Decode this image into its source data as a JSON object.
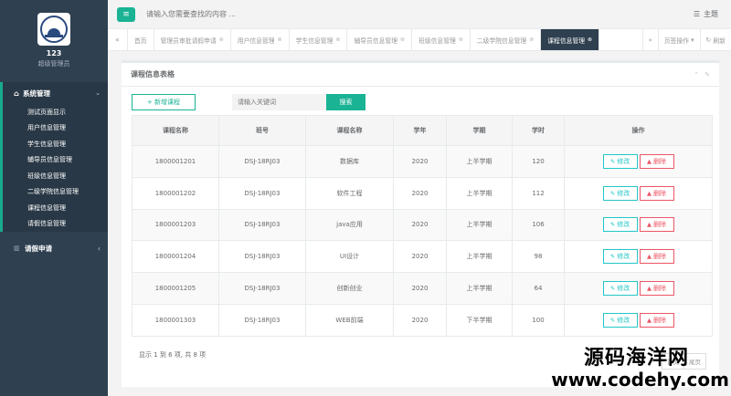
{
  "profile": {
    "username": "123",
    "role": "超级管理员"
  },
  "sidebar": {
    "group_label": "系统管理",
    "items": [
      {
        "label": "测试页面显示"
      },
      {
        "label": "用户信息管理"
      },
      {
        "label": "学生信息管理"
      },
      {
        "label": "辅导员信息管理"
      },
      {
        "label": "班级信息管理"
      },
      {
        "label": "二级学院信息管理"
      },
      {
        "label": "课程信息管理"
      },
      {
        "label": "请假信息管理"
      }
    ],
    "group2_label": "请假申请"
  },
  "topbar": {
    "search_placeholder": "请输入您需要查找的内容 ...",
    "theme_label": "主题"
  },
  "tabs": [
    {
      "label": "首页",
      "closable": false
    },
    {
      "label": "管理员审批请假申请",
      "closable": true
    },
    {
      "label": "用户信息管理",
      "closable": true
    },
    {
      "label": "学生信息管理",
      "closable": true
    },
    {
      "label": "辅导员信息管理",
      "closable": true
    },
    {
      "label": "班级信息管理",
      "closable": true
    },
    {
      "label": "二级学院信息管理",
      "closable": true
    },
    {
      "label": "课程信息管理",
      "closable": true,
      "active": true
    }
  ],
  "tab_actions": {
    "page_ops": "页签操作",
    "refresh": "刷新"
  },
  "panel": {
    "title": "课程信息表格",
    "add_button": "新增课程",
    "keyword_placeholder": "请输入关键词",
    "search_button": "搜索"
  },
  "table": {
    "headers": [
      "课程名称",
      "班号",
      "课程名称",
      "学年",
      "学期",
      "学时",
      "操作"
    ],
    "rows": [
      [
        "1800001201",
        "DSJ-18RJ03",
        "数据库",
        "2020",
        "上半学期",
        "120"
      ],
      [
        "1800001202",
        "DSJ-18RJ03",
        "软件工程",
        "2020",
        "上半学期",
        "112"
      ],
      [
        "1800001203",
        "DSJ-18RJ03",
        "java应用",
        "2020",
        "上半学期",
        "106"
      ],
      [
        "1800001204",
        "DSJ-18RJ03",
        "UI设计",
        "2020",
        "上半学期",
        "98"
      ],
      [
        "1800001205",
        "DSJ-18RJ03",
        "创新创业",
        "2020",
        "上半学期",
        "64"
      ],
      [
        "1800001303",
        "DSJ-18RJ03",
        "WEB前端",
        "2020",
        "下半学期",
        "100"
      ]
    ],
    "edit_label": "修改",
    "delete_label": "删除"
  },
  "pager": {
    "info": "显示 1 到 6 项, 共 8 项",
    "first": "首页",
    "last": "尾页"
  },
  "watermark": {
    "line1": "源码海洋网",
    "line2": "www.codehy.com"
  },
  "colors": {
    "sidebar_bg": "#2f4050",
    "accent": "#1ab394",
    "edit": "#23c6c8",
    "delete": "#ed5565"
  }
}
